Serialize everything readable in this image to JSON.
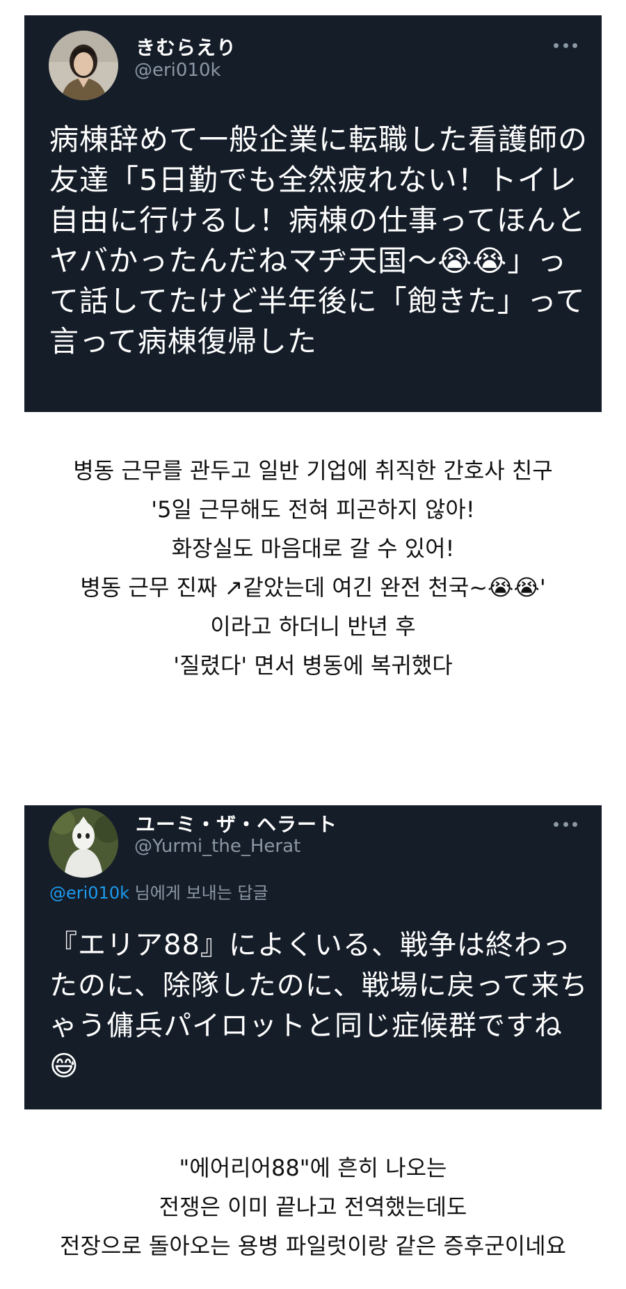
{
  "tweets": [
    {
      "display_name": "きむらえり",
      "handle": "@eri010k",
      "avatar_icon": "profile-photo",
      "more_icon": "more-horizontal-icon",
      "text": "病棟辞めて一般企業に転職した看護師の友達「5日勤でも全然疲れない！トイレ自由に行けるし！病棟の仕事ってほんとヤバかったんだねマヂ天国〜😭😭」って話してたけど半年後に「飽きた」って言って病棟復帰した"
    },
    {
      "display_name": "ユーミ・ザ・ヘラート",
      "handle": "@Yurmi_the_Herat",
      "avatar_icon": "profile-photo",
      "more_icon": "more-horizontal-icon",
      "reply_mention": "@eri010k",
      "reply_suffix": " 님에게 보내는 답글",
      "text": "『エリア88』によくいる、戦争は終わったのに、除隊したのに、戦場に戻って来ちゃう傭兵パイロットと同じ症候群ですね😅"
    }
  ],
  "translations": [
    {
      "lines": [
        "병동 근무를 관두고 일반 기업에 취직한 간호사 친구",
        "'5일 근무해도 전혀 피곤하지 않아!",
        "화장실도 마음대로 갈 수 있어!",
        "병동 근무 진짜 ↗같았는데 여긴 완전 천국~😭😭'",
        "이라고 하더니 반년 후",
        "'질렸다' 면서 병동에 복귀했다"
      ]
    },
    {
      "lines": [
        "\"에어리어88\"에 흔히 나오는",
        "전쟁은 이미 끝나고 전역했는데도",
        "전장으로 돌아오는 용병 파일럿이랑 같은 증후군이네요"
      ]
    }
  ]
}
